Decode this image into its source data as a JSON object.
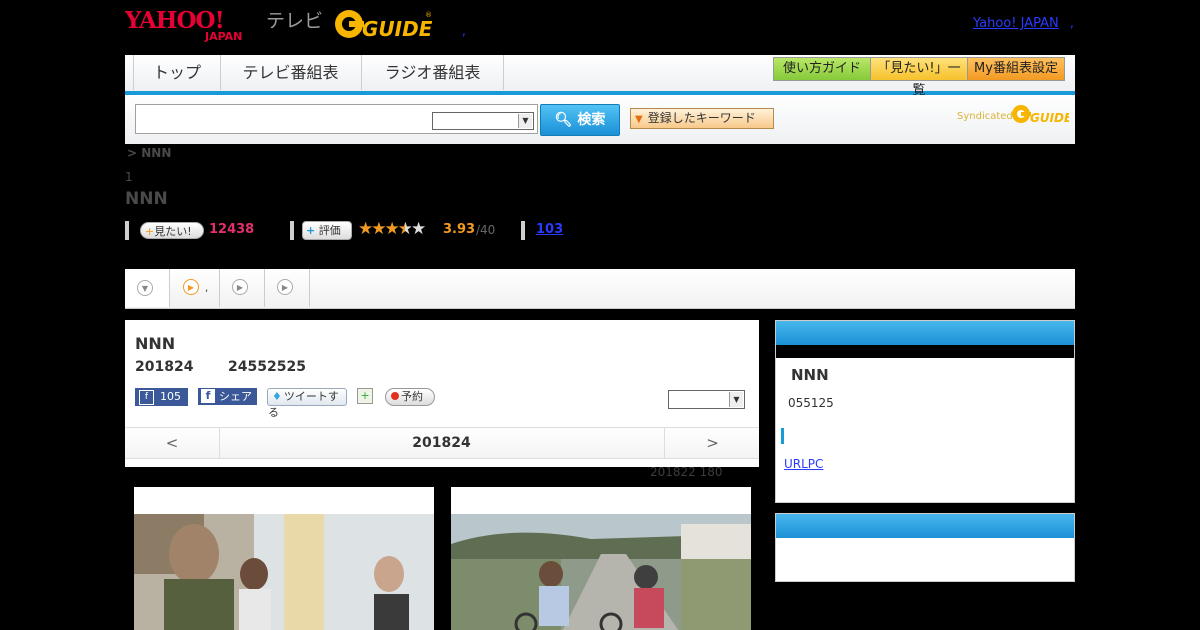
{
  "header": {
    "logo_text": "YAHOO! JAPAN",
    "tv_label": "テレビ",
    "gguide_logo_text": "G GUIDE",
    "yahoo_japan_link": "Yahoo! JAPAN"
  },
  "nav": {
    "tabs": [
      {
        "label": "トップ"
      },
      {
        "label": "テレビ番組表"
      },
      {
        "label": "ラジオ番組表"
      }
    ],
    "guide_button": "使い方ガイド",
    "mitai_list_button": "「見たい!」一覧",
    "my_schedule_button": "My番組表設定"
  },
  "search": {
    "button_label": "検索",
    "keyword_button": "登録したキーワード",
    "syndicated_label": "Syndicated"
  },
  "program": {
    "breadcrumb": "> NNN",
    "crumb_number": "1",
    "title": "NNN",
    "mitai_label": "見たい!",
    "mitai_count": "12438",
    "rate_label": "評価",
    "stars": "★★★★★",
    "rating": "3.93",
    "rating_max": "/40",
    "review_count": "103"
  },
  "episode": {
    "title": "NNN",
    "date": "201824",
    "time": "24552525",
    "fb_like_count": "105",
    "fb_share_label": "シェア",
    "tweet_label": "ツイートする",
    "reserve_label": "予約",
    "pager_prev": "<",
    "pager_date": "201824",
    "pager_next": ">",
    "update_note": "201822  180"
  },
  "sidebar": {
    "title": "NNN",
    "code": "055125",
    "url_link": "URLPC"
  },
  "colors": {
    "accent_blue": "#1a9ad6",
    "mitai_pink": "#e0306c",
    "rating_orange": "#f29a22",
    "link_blue": "#2a3bff"
  }
}
